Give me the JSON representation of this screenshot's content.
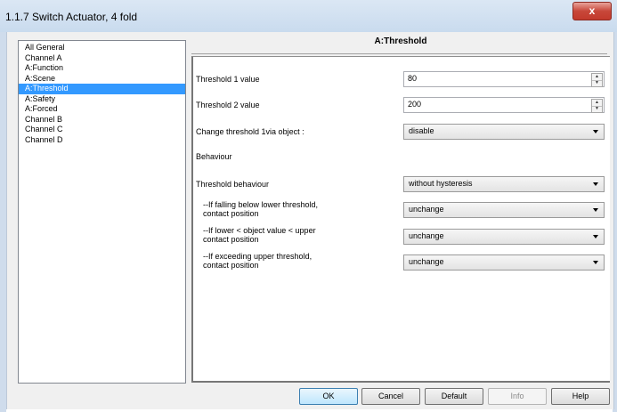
{
  "window": {
    "title": "1.1.7 Switch Actuator, 4 fold",
    "close_symbol": "x"
  },
  "nav": {
    "items": [
      {
        "label": "All General",
        "selected": false
      },
      {
        "label": "Channel A",
        "selected": false
      },
      {
        "label": "A:Function",
        "selected": false
      },
      {
        "label": "A:Scene",
        "selected": false
      },
      {
        "label": "A:Threshold",
        "selected": true
      },
      {
        "label": "A:Safety",
        "selected": false
      },
      {
        "label": "A:Forced",
        "selected": false
      },
      {
        "label": "Channel B",
        "selected": false
      },
      {
        "label": "Channel C",
        "selected": false
      },
      {
        "label": "Channel D",
        "selected": false
      }
    ]
  },
  "panel": {
    "title": "A:Threshold",
    "threshold1_label": "Threshold 1 value",
    "threshold1_value": "80",
    "threshold2_label": "Threshold 2 value",
    "threshold2_value": "200",
    "change_label": "Change threshold 1via object :",
    "change_value": "disable",
    "behaviour_heading": "Behaviour",
    "behaviour_label": "Threshold behaviour",
    "behaviour_value": "without hysteresis",
    "falling_label_1": "--If falling below lower threshold,",
    "falling_label_2": "contact position",
    "falling_value": "unchange",
    "between_label_1": "--If lower < object value < upper",
    "between_label_2": "contact position",
    "between_value": "unchange",
    "exceeding_label_1": "--If exceeding upper threshold,",
    "exceeding_label_2": "contact position",
    "exceeding_value": "unchange"
  },
  "buttons": {
    "ok": "OK",
    "cancel": "Cancel",
    "default": "Default",
    "info": "Info",
    "help": "Help"
  },
  "colors": {
    "selection": "#3399ff",
    "close_button": "#c8473a"
  }
}
